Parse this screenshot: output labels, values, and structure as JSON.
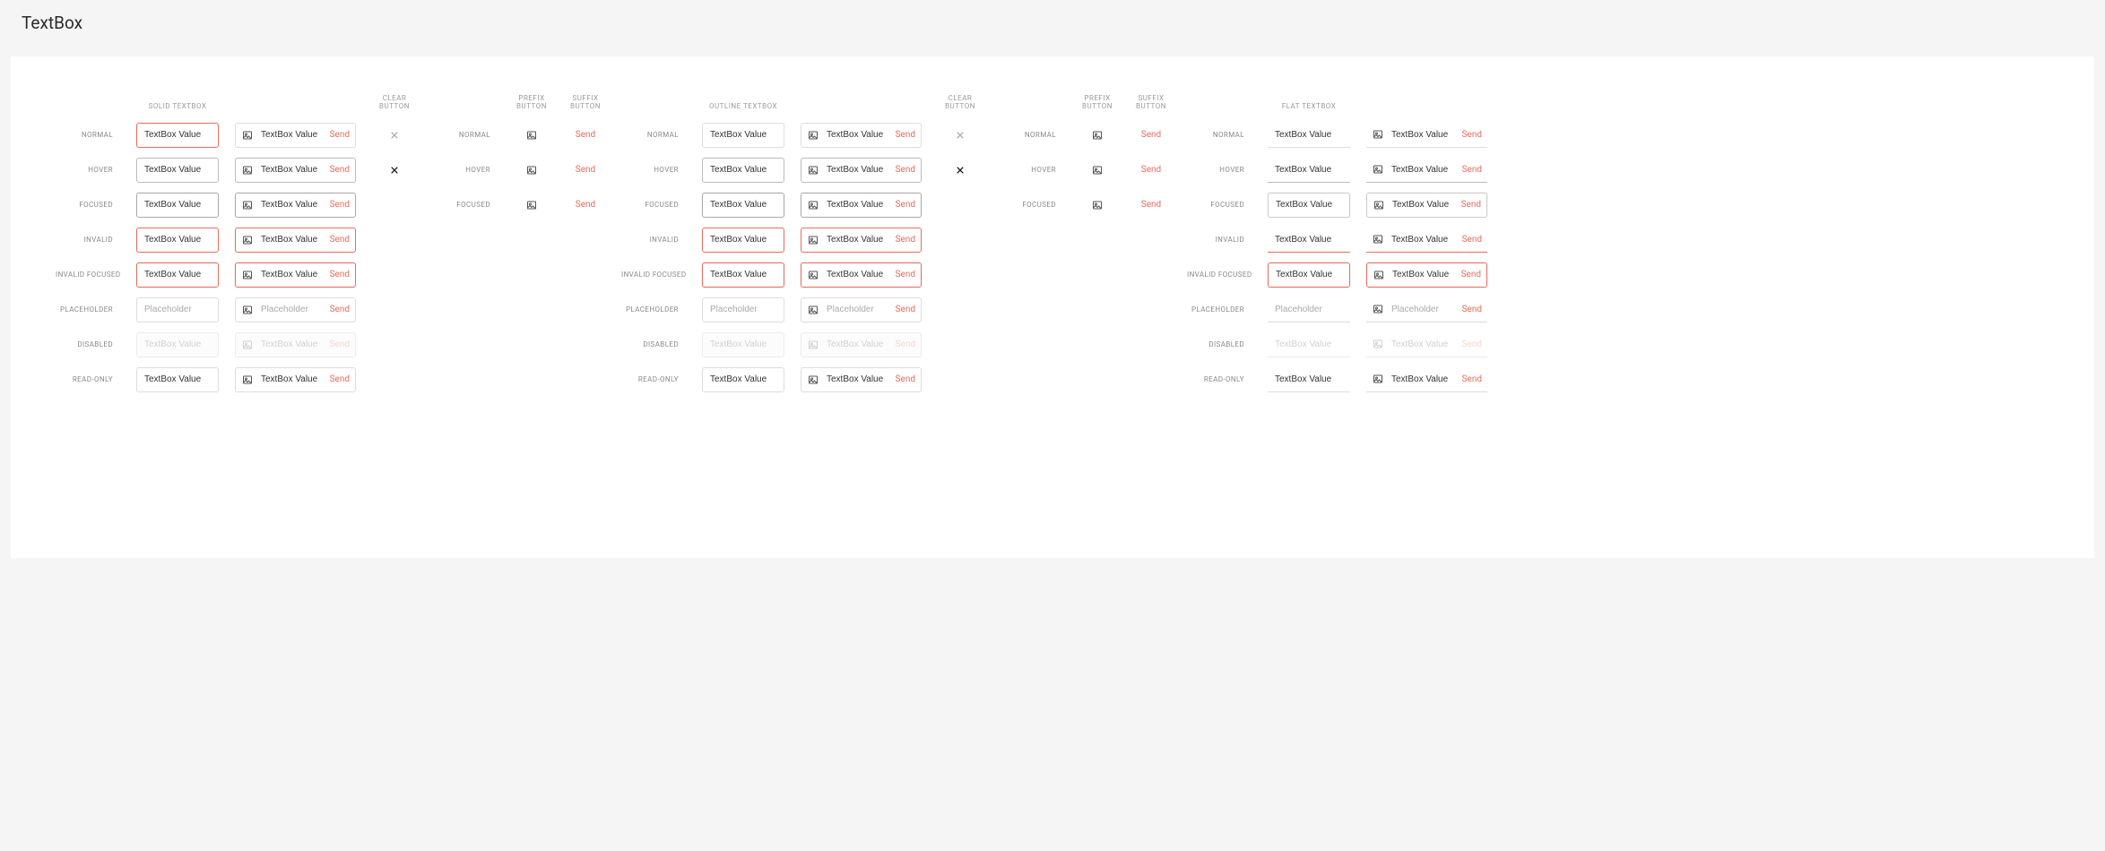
{
  "page_title": "TextBox",
  "headers": {
    "solid": "SOLID TEXTBOX",
    "outline": "OUTLINE TEXTBOX",
    "flat": "FLAT TEXTBOX",
    "clear": "CLEAR BUTTON",
    "prefix": "PREFIX BUTTON",
    "suffix": "SUFFIX BUTTON"
  },
  "states": {
    "normal": "NORMAL",
    "hover": "HOVER",
    "focused": "FOCUSED",
    "invalid": "INVALID",
    "invalid_focused": "INVALID FOCUSED",
    "placeholder": "PLACEHOLDER",
    "disabled": "DISABLED",
    "readonly": "READ-ONLY"
  },
  "value": "TextBox Value",
  "placeholder": "Placeholder",
  "send": "Send"
}
